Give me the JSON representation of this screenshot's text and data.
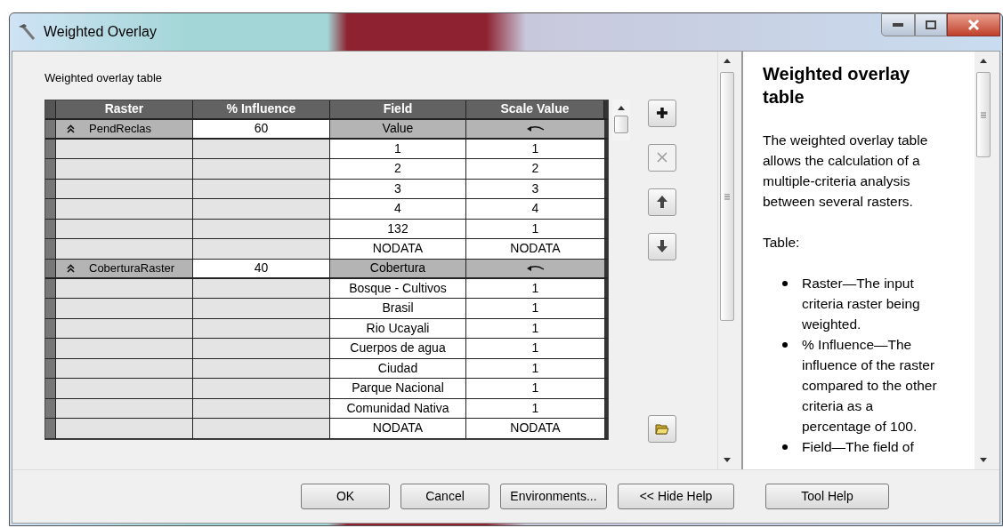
{
  "window": {
    "title": "Weighted Overlay"
  },
  "table_label": "Weighted overlay table",
  "table": {
    "columns": [
      "Raster",
      "% Influence",
      "Field",
      "Scale Value"
    ],
    "groups": [
      {
        "raster": "PendReclas",
        "influence": "60",
        "field": "Value",
        "rows": [
          {
            "field": "1",
            "scale": "1"
          },
          {
            "field": "2",
            "scale": "2"
          },
          {
            "field": "3",
            "scale": "3"
          },
          {
            "field": "4",
            "scale": "4"
          },
          {
            "field": "132",
            "scale": "1"
          },
          {
            "field": "NODATA",
            "scale": "NODATA"
          }
        ]
      },
      {
        "raster": "CoberturaRaster",
        "influence": "40",
        "field": "Cobertura",
        "rows": [
          {
            "field": "Bosque - Cultivos",
            "scale": "1"
          },
          {
            "field": "Brasil",
            "scale": "1"
          },
          {
            "field": "Rio Ucayali",
            "scale": "1"
          },
          {
            "field": "Cuerpos de agua",
            "scale": "1"
          },
          {
            "field": "Ciudad",
            "scale": "1"
          },
          {
            "field": "Parque Nacional",
            "scale": "1"
          },
          {
            "field": "Comunidad Nativa",
            "scale": "1"
          },
          {
            "field": "NODATA",
            "scale": "NODATA"
          }
        ]
      }
    ]
  },
  "side_tools": [
    {
      "kind": "add",
      "disabled": false
    },
    {
      "kind": "remove",
      "disabled": true
    },
    {
      "kind": "up",
      "disabled": false
    },
    {
      "kind": "down",
      "disabled": false
    },
    {
      "kind": "open",
      "disabled": false
    }
  ],
  "help": {
    "title": "Weighted overlay table",
    "paragraphs": [
      "The weighted overlay table allows the calculation of a multiple-criteria analysis between several rasters.",
      "Table:"
    ],
    "bullets": [
      "Raster—The input criteria raster being weighted.",
      "% Influence—The influence of the raster compared to the other criteria as a percentage of 100.",
      "Field—The field of"
    ]
  },
  "buttons": [
    "OK",
    "Cancel",
    "Environments...",
    "<< Hide Help",
    "Tool Help"
  ]
}
